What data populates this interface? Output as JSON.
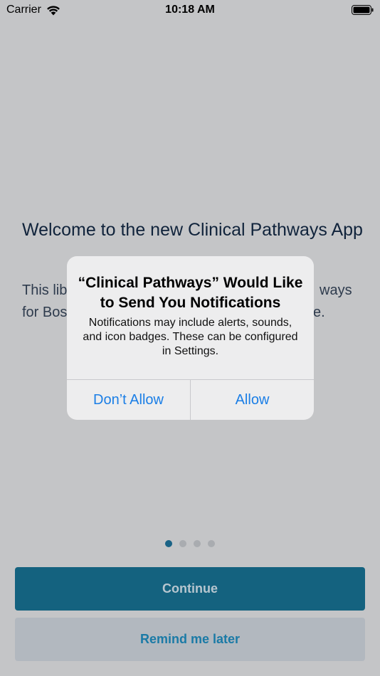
{
  "status_bar": {
    "carrier": "Carrier",
    "time": "10:18 AM"
  },
  "welcome": {
    "title": "Welcome to the new Clinical Pathways App",
    "body_line1_left": "This lib",
    "body_line1_right": "ways",
    "body_line2_left": "for Bos",
    "body_line2_right": "e."
  },
  "pager": {
    "total": 4,
    "active_index": 0
  },
  "buttons": {
    "continue": "Continue",
    "remind": "Remind me later"
  },
  "alert": {
    "title": "“Clinical Pathways” Would Like to Send You Notifications",
    "message": "Notifications may include alerts, sounds, and icon badges. These can be configured in Settings.",
    "dont_allow": "Don’t Allow",
    "allow": "Allow"
  },
  "colors": {
    "accent": "#14627f",
    "alert_button": "#1a7ee6",
    "dim_background": "#c4c5c7"
  }
}
